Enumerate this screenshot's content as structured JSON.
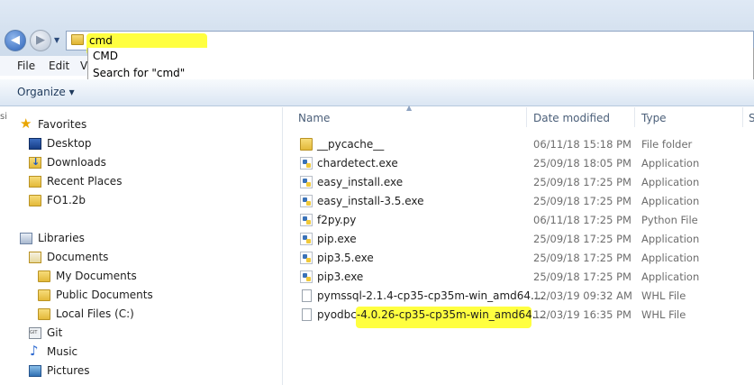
{
  "address": {
    "value": "cmd"
  },
  "menu": {
    "file": "File",
    "edit": "Edit",
    "view": "V"
  },
  "suggestions": [
    "CMD",
    "Search for \"cmd\""
  ],
  "toolbar": {
    "organize": "Organize ▾"
  },
  "nav": {
    "favorites": "Favorites",
    "desktop": "Desktop",
    "downloads": "Downloads",
    "recent_places": "Recent Places",
    "fo12b": "FO1.2b",
    "libraries": "Libraries",
    "documents": "Documents",
    "my_documents": "My Documents",
    "public_documents": "Public Documents",
    "local_files": "Local Files (C:)",
    "git": "Git",
    "music": "Music",
    "pictures": "Pictures"
  },
  "columns": {
    "name": "Name",
    "date": "Date modified",
    "type": "Type",
    "size": "S"
  },
  "files": [
    {
      "name": "__pycache__",
      "date": "06/11/18 15:18 PM",
      "type": "File folder"
    },
    {
      "name": "chardetect.exe",
      "date": "25/09/18 18:05 PM",
      "type": "Application"
    },
    {
      "name": "easy_install.exe",
      "date": "25/09/18 17:25 PM",
      "type": "Application"
    },
    {
      "name": "easy_install-3.5.exe",
      "date": "25/09/18 17:25 PM",
      "type": "Application"
    },
    {
      "name": "f2py.py",
      "date": "06/11/18 17:25 PM",
      "type": "Python File"
    },
    {
      "name": "pip.exe",
      "date": "25/09/18 17:25 PM",
      "type": "Application"
    },
    {
      "name": "pip3.5.exe",
      "date": "25/09/18 17:25 PM",
      "type": "Application"
    },
    {
      "name": "pip3.exe",
      "date": "25/09/18 17:25 PM",
      "type": "Application"
    },
    {
      "name": "pymssql-2.1.4-cp35-cp35m-win_amd64....",
      "date": "12/03/19 09:32 AM",
      "type": "WHL File"
    },
    {
      "name": "pyodbc-4.0.26-cp35-cp35m-win_amd64....",
      "date": "12/03/19 16:35 PM",
      "type": "WHL File"
    }
  ]
}
